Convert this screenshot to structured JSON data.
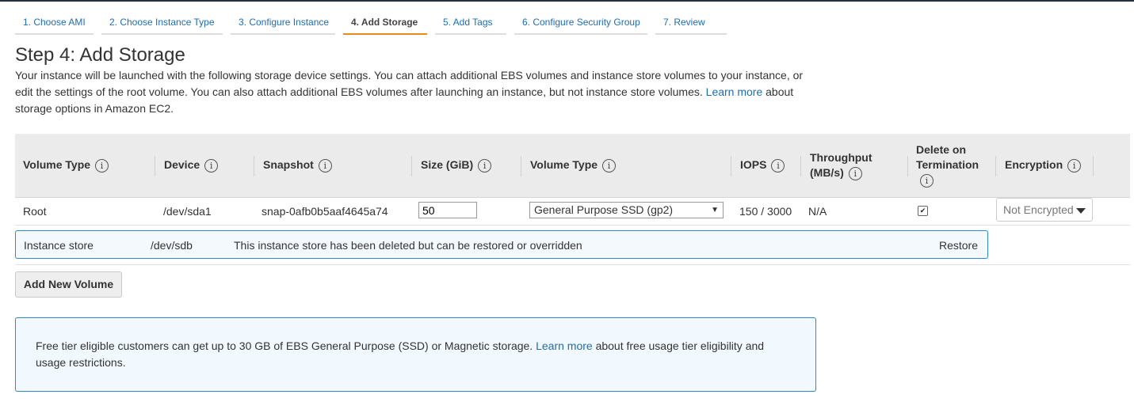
{
  "tabs": [
    {
      "label": "1. Choose AMI",
      "active": false
    },
    {
      "label": "2. Choose Instance Type",
      "active": false
    },
    {
      "label": "3. Configure Instance",
      "active": false
    },
    {
      "label": "4. Add Storage",
      "active": true
    },
    {
      "label": "5. Add Tags",
      "active": false
    },
    {
      "label": "6. Configure Security Group",
      "active": false
    },
    {
      "label": "7. Review",
      "active": false
    }
  ],
  "page": {
    "title": "Step 4: Add Storage",
    "intro_text": "Your instance will be launched with the following storage device settings. You can attach additional EBS volumes and instance store volumes to your instance, or edit the settings of the root volume. You can also attach additional EBS volumes after launching an instance, but not instance store volumes.",
    "intro_link": "Learn more",
    "intro_suffix": "about storage options in Amazon EC2."
  },
  "table": {
    "headers": {
      "volume_type": "Volume Type",
      "device": "Device",
      "snapshot": "Snapshot",
      "size": "Size (GiB)",
      "ebs_type": "Volume Type",
      "iops": "IOPS",
      "throughput_line1": "Throughput",
      "throughput_line2": "(MB/s)",
      "delete_line1": "Delete on",
      "delete_line2": "Termination",
      "encryption": "Encryption",
      "info_glyph": "i"
    },
    "root_row": {
      "volume_type": "Root",
      "device": "/dev/sda1",
      "snapshot": "snap-0afb0b5aaf4645a74",
      "size": "50",
      "ebs_type": "General Purpose SSD (gp2)",
      "iops": "150 / 3000",
      "throughput": "N/A",
      "delete_on_termination": true,
      "checkbox_glyph": "✔",
      "encryption": "Not Encrypted"
    },
    "instance_store_row": {
      "volume_type": "Instance store",
      "device": "/dev/sdb",
      "message": "This instance store has been deleted but can be restored or overridden",
      "action": "Restore"
    }
  },
  "add_volume_label": "Add New Volume",
  "notice": {
    "text": "Free tier eligible customers can get up to 30 GB of EBS General Purpose (SSD) or Magnetic storage.",
    "link": "Learn more",
    "suffix": "about free usage tier eligibility and usage restrictions."
  },
  "colors": {
    "accent_tab": "#e88b1a",
    "link": "#1f6cb2",
    "notice_border": "#2e8ac4"
  }
}
